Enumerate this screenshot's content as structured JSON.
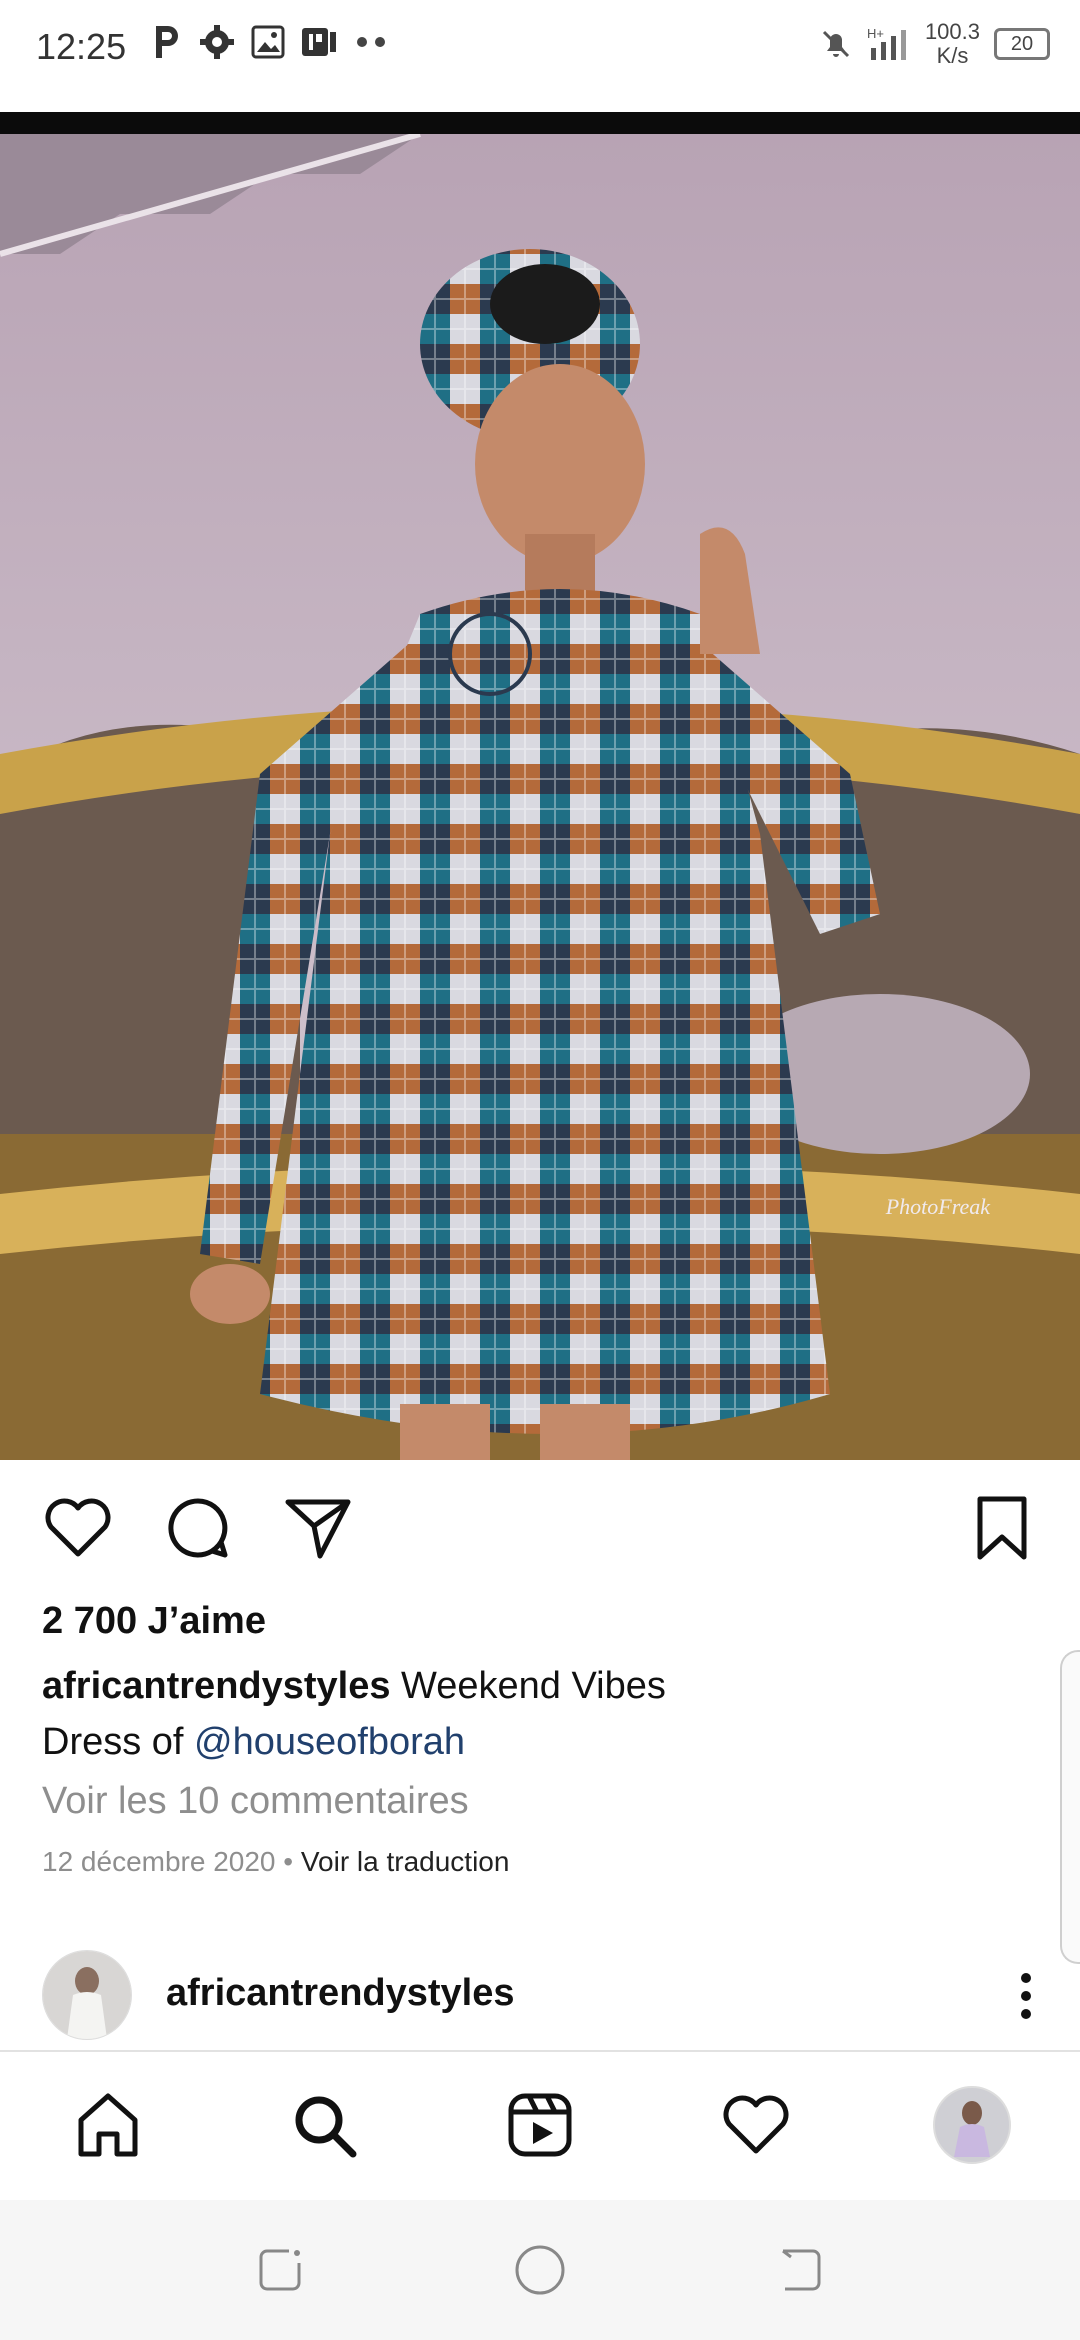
{
  "status_bar": {
    "time": "12:25",
    "left_icons": [
      "parking-icon",
      "gear-icon",
      "image-icon",
      "app-icon",
      "more-dots-icon"
    ],
    "net_speed_value": "100.3",
    "net_speed_unit": "K/s",
    "battery": "20"
  },
  "post": {
    "photo_watermark": "PhotoFreak",
    "likes": "2 700 J’aime",
    "caption_user": "africantrendystyles",
    "caption_text": " Weekend Vibes",
    "caption_line2_prefix": "Dress of ",
    "caption_mention": "@houseofborah",
    "view_comments": "Voir les 10 commentaires",
    "date": "12 décembre 2020",
    "separator": " • ",
    "translate": "Voir la traduction"
  },
  "next_post": {
    "username": "africantrendystyles"
  },
  "bottom_nav": [
    "home-icon",
    "search-icon",
    "reels-icon",
    "heart-icon",
    "profile-avatar"
  ],
  "colors": {
    "mention": "#21406d",
    "muted": "#8e8e8e",
    "dress_teal": "#1f6f85",
    "gold": "#c9a24a"
  }
}
